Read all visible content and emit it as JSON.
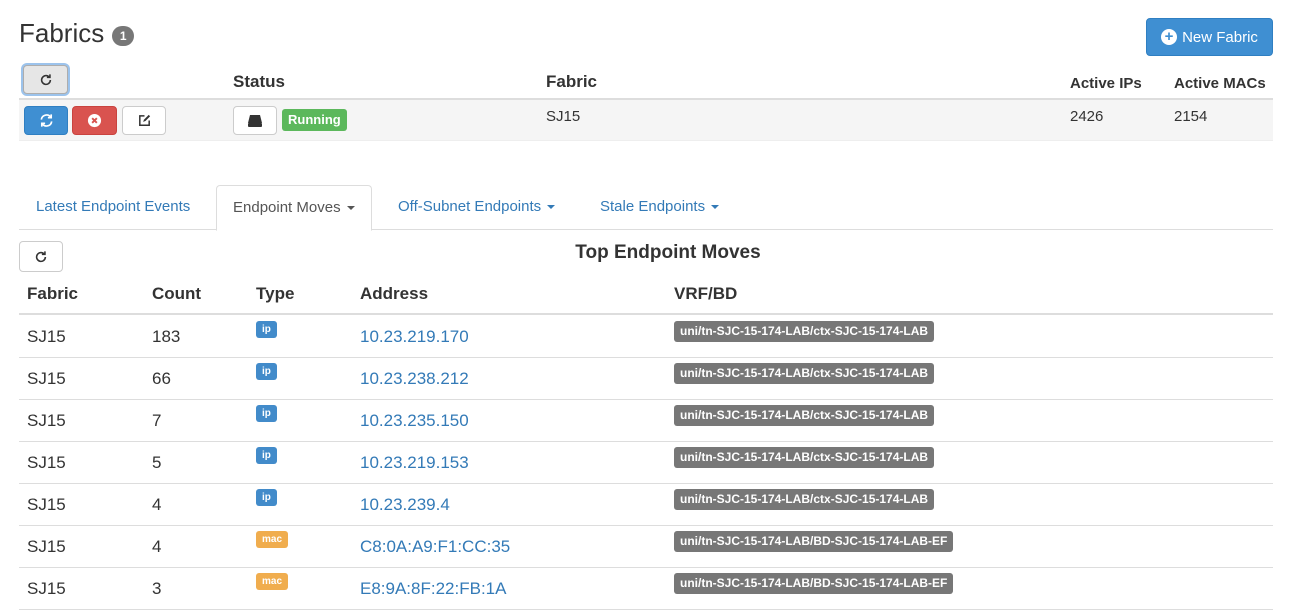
{
  "header": {
    "title": "Fabrics",
    "count_badge": "1",
    "new_fabric_label": "New Fabric"
  },
  "fabric_table": {
    "columns": {
      "status": "Status",
      "fabric": "Fabric",
      "active_ips": "Active IPs",
      "active_macs": "Active MACs"
    },
    "rows": [
      {
        "status_label": "Running",
        "fabric": "SJ15",
        "active_ips": "2426",
        "active_macs": "2154"
      }
    ]
  },
  "tabs": [
    {
      "label": "Latest Endpoint Events",
      "dropdown": false,
      "active": false
    },
    {
      "label": "Endpoint Moves",
      "dropdown": true,
      "active": true
    },
    {
      "label": "Off-Subnet Endpoints",
      "dropdown": true,
      "active": false
    },
    {
      "label": "Stale Endpoints",
      "dropdown": true,
      "active": false
    }
  ],
  "moves": {
    "title": "Top Endpoint Moves",
    "columns": {
      "fabric": "Fabric",
      "count": "Count",
      "type": "Type",
      "address": "Address",
      "vrf_bd": "VRF/BD"
    },
    "rows": [
      {
        "fabric": "SJ15",
        "count": "183",
        "type": "ip",
        "address": "10.23.219.170",
        "vrf_bd": "uni/tn-SJC-15-174-LAB/ctx-SJC-15-174-LAB"
      },
      {
        "fabric": "SJ15",
        "count": "66",
        "type": "ip",
        "address": "10.23.238.212",
        "vrf_bd": "uni/tn-SJC-15-174-LAB/ctx-SJC-15-174-LAB"
      },
      {
        "fabric": "SJ15",
        "count": "7",
        "type": "ip",
        "address": "10.23.235.150",
        "vrf_bd": "uni/tn-SJC-15-174-LAB/ctx-SJC-15-174-LAB"
      },
      {
        "fabric": "SJ15",
        "count": "5",
        "type": "ip",
        "address": "10.23.219.153",
        "vrf_bd": "uni/tn-SJC-15-174-LAB/ctx-SJC-15-174-LAB"
      },
      {
        "fabric": "SJ15",
        "count": "4",
        "type": "ip",
        "address": "10.23.239.4",
        "vrf_bd": "uni/tn-SJC-15-174-LAB/ctx-SJC-15-174-LAB"
      },
      {
        "fabric": "SJ15",
        "count": "4",
        "type": "mac",
        "address": "C8:0A:A9:F1:CC:35",
        "vrf_bd": "uni/tn-SJC-15-174-LAB/BD-SJC-15-174-LAB-EF"
      },
      {
        "fabric": "SJ15",
        "count": "3",
        "type": "mac",
        "address": "E8:9A:8F:22:FB:1A",
        "vrf_bd": "uni/tn-SJC-15-174-LAB/BD-SJC-15-174-LAB-EF"
      }
    ]
  },
  "colors": {
    "primary": "#3f8fd2",
    "danger": "#d9534f",
    "success": "#5cb85c",
    "ip_badge": "#428bca",
    "mac_badge": "#f0ad4e",
    "vrf_badge": "#777777",
    "link": "#337ab7"
  },
  "icons": {
    "refresh": "refresh-icon",
    "close": "close-circle-icon",
    "edit": "edit-icon",
    "drive": "hard-drive-icon",
    "plus": "plus-circle-icon"
  }
}
